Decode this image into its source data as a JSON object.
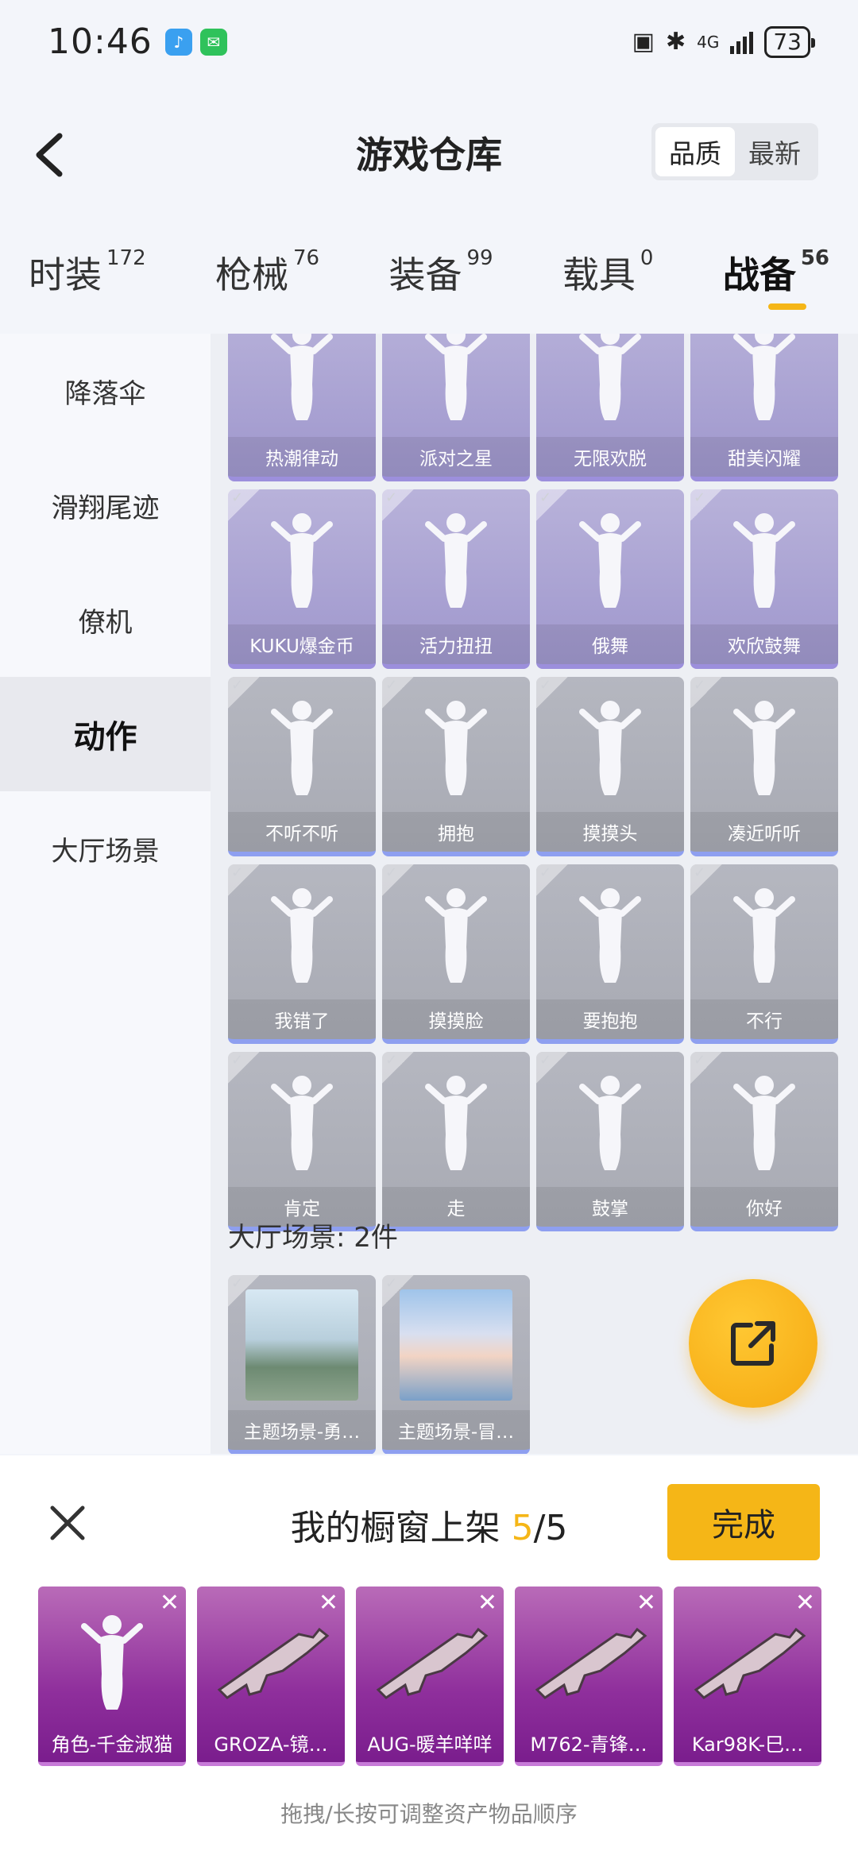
{
  "status": {
    "time": "10:46",
    "network": "4G",
    "battery": "73"
  },
  "header": {
    "title": "游戏仓库",
    "sort_options": [
      "品质",
      "最新"
    ],
    "active_sort": 0
  },
  "tabs": [
    {
      "label": "时装",
      "count": "172"
    },
    {
      "label": "枪械",
      "count": "76"
    },
    {
      "label": "装备",
      "count": "99"
    },
    {
      "label": "载具",
      "count": "0"
    },
    {
      "label": "战备",
      "count": "56"
    }
  ],
  "active_tab": 4,
  "sidebar": {
    "items": [
      "降落伞",
      "滑翔尾迹",
      "僚机",
      "动作",
      "大厅场景"
    ],
    "active": 3
  },
  "actions": [
    {
      "label": "热潮律动",
      "tier": "purple"
    },
    {
      "label": "派对之星",
      "tier": "purple"
    },
    {
      "label": "无限欢脱",
      "tier": "purple"
    },
    {
      "label": "甜美闪耀",
      "tier": "purple"
    },
    {
      "label": "KUKU爆金币",
      "tier": "purple"
    },
    {
      "label": "活力扭扭",
      "tier": "purple"
    },
    {
      "label": "俄舞",
      "tier": "purple"
    },
    {
      "label": "欢欣鼓舞",
      "tier": "purple"
    },
    {
      "label": "不听不听",
      "tier": "gray"
    },
    {
      "label": "拥抱",
      "tier": "gray"
    },
    {
      "label": "摸摸头",
      "tier": "gray"
    },
    {
      "label": "凑近听听",
      "tier": "gray"
    },
    {
      "label": "我错了",
      "tier": "gray"
    },
    {
      "label": "摸摸脸",
      "tier": "gray"
    },
    {
      "label": "要抱抱",
      "tier": "gray"
    },
    {
      "label": "不行",
      "tier": "gray"
    },
    {
      "label": "肯定",
      "tier": "gray"
    },
    {
      "label": "走",
      "tier": "gray"
    },
    {
      "label": "鼓掌",
      "tier": "gray"
    },
    {
      "label": "你好",
      "tier": "gray"
    }
  ],
  "scenes_section": {
    "title": "大厅场景: 2件"
  },
  "scenes": [
    {
      "label": "主题场景-勇…"
    },
    {
      "label": "主题场景-冒…"
    }
  ],
  "sheet": {
    "title_prefix": "我的橱窗上架 ",
    "count_current": "5",
    "count_sep": "/5",
    "done_label": "完成",
    "hint": "拖拽/长按可调整资产物品顺序",
    "items": [
      {
        "label": "角色-千金淑猫",
        "icon": "character-icon"
      },
      {
        "label": "GROZA-镜…",
        "icon": "rifle-icon"
      },
      {
        "label": "AUG-暖羊咩咩",
        "icon": "rifle-icon"
      },
      {
        "label": "M762-青锋…",
        "icon": "rifle-icon"
      },
      {
        "label": "Kar98K-巳…",
        "icon": "sniper-icon"
      }
    ]
  },
  "colors": {
    "accent": "#f5b617",
    "purple_tier": "#9f97cd",
    "showcase_tier": "#8f2f9c"
  }
}
